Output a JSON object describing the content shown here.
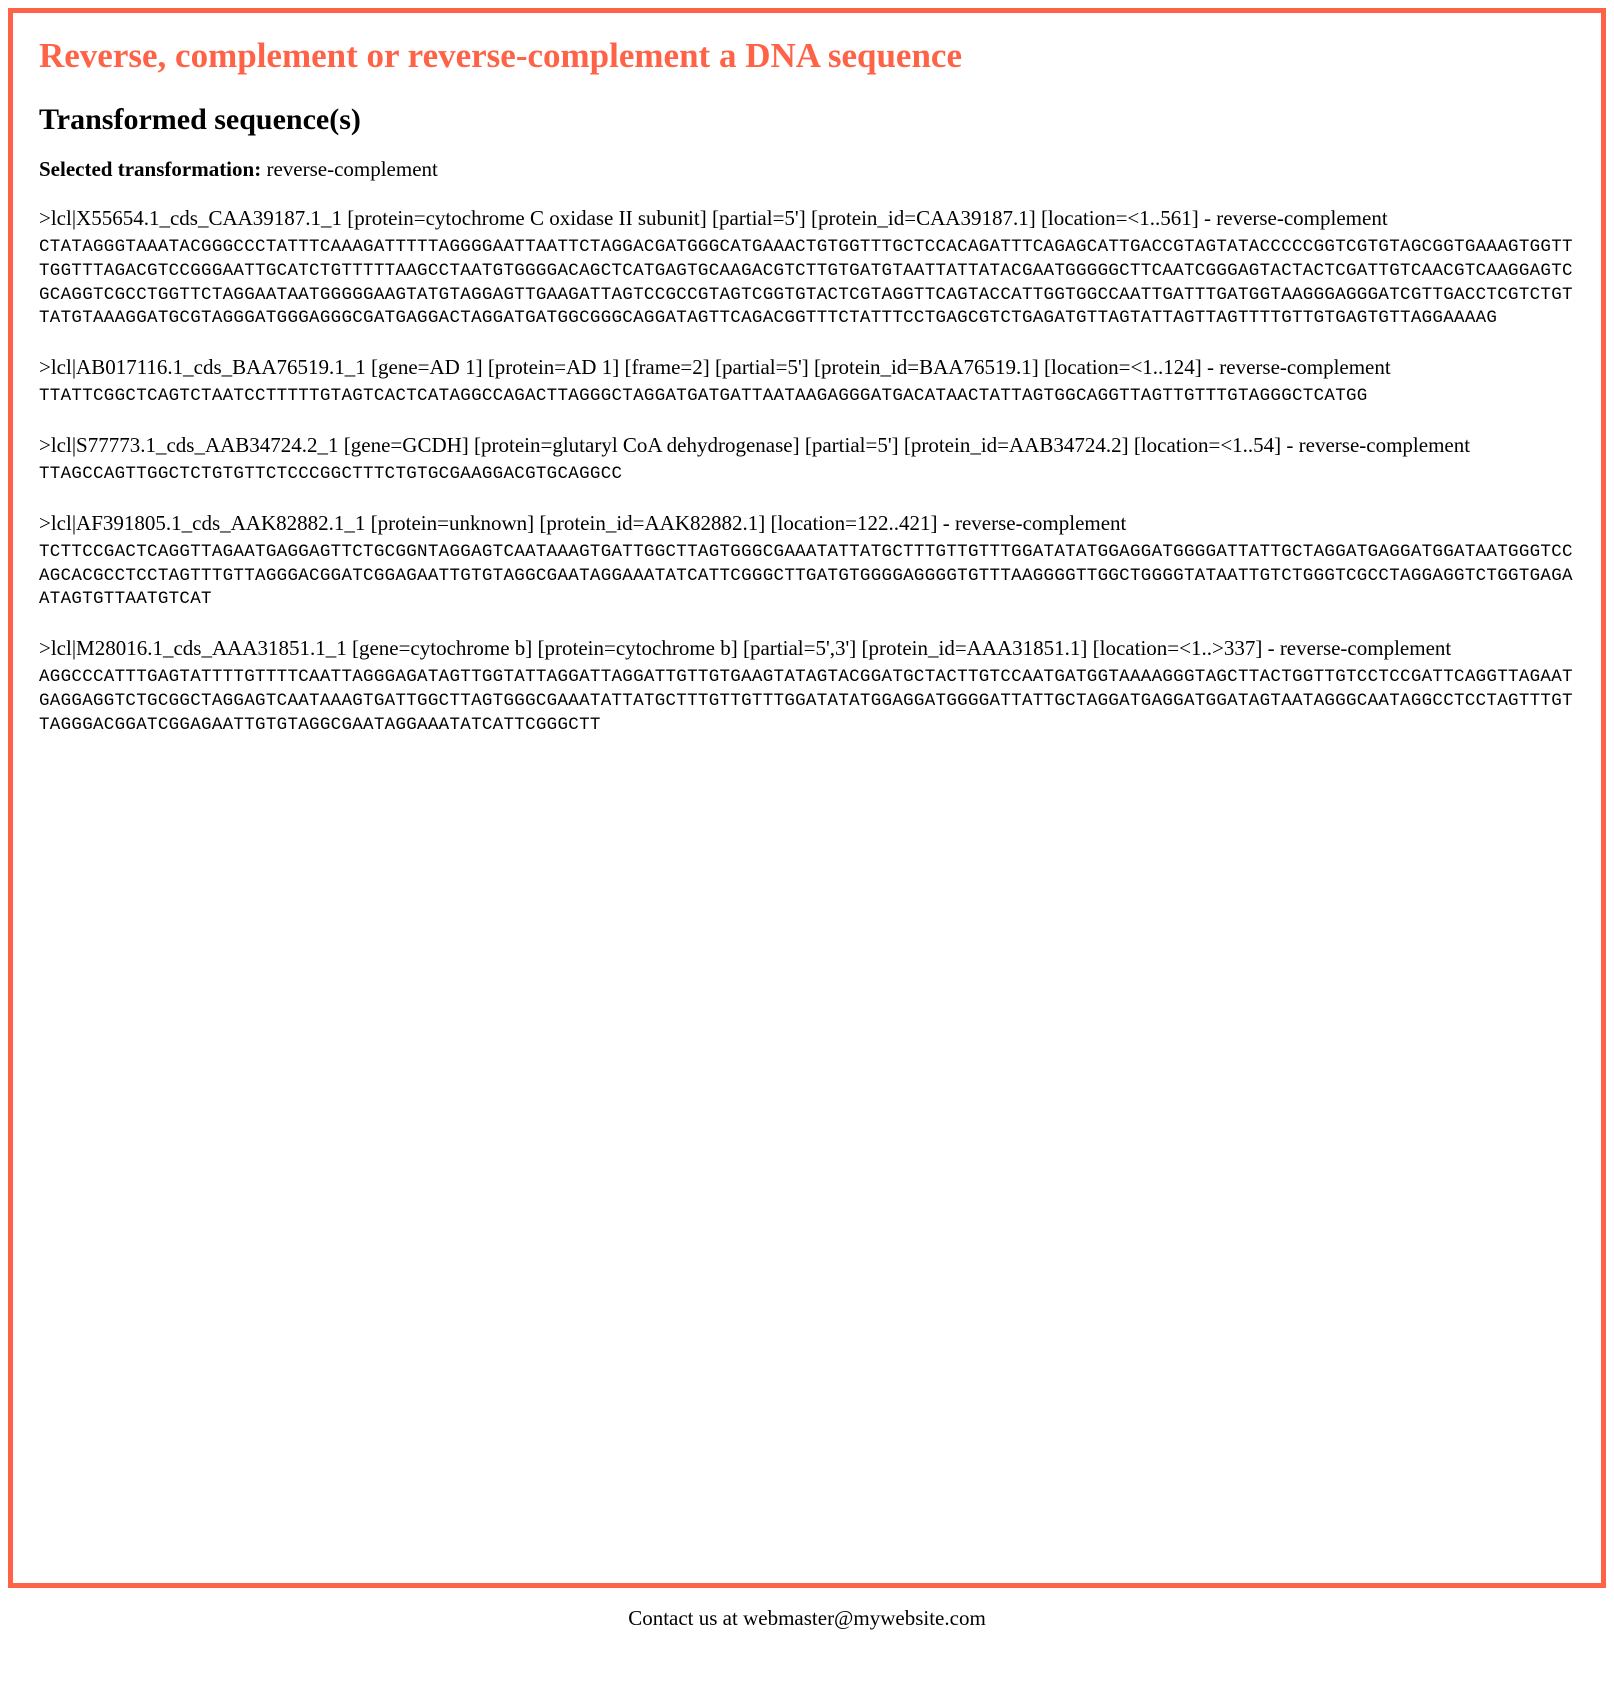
{
  "title": "Reverse, complement or reverse-complement a DNA sequence",
  "subtitle": "Transformed sequence(s)",
  "selected_transformation_label": "Selected transformation:",
  "selected_transformation_value": "reverse-complement",
  "sequences": [
    {
      "header": ">lcl|X55654.1_cds_CAA39187.1_1 [protein=cytochrome C oxidase II subunit] [partial=5'] [protein_id=CAA39187.1] [location=<1..561] - reverse-complement",
      "data": "CTATAGGGTAAATACGGGCCCTATTTCAAAGATTTTTAGGGGAATTAATTCTAGGACGATGGGCATGAAACTGTGGTTTGCTCCACAGATTTCAGAGCATTGACCGTAGTATACCCCCGGTCGTGTAGCGGTGAAAGTGGTTTGGTTTAGACGTCCGGGAATTGCATCTGTTTTTAAGCCTAATGTGGGGACAGCTCATGAGTGCAAGACGTCTTGTGATGTAATTATTATACGAATGGGGGCTTCAATCGGGAGTACTACTCGATTGTCAACGTCAAGGAGTCGCAGGTCGCCTGGTTCTAGGAATAATGGGGGAAGTATGTAGGAGTTGAAGATTAGTCCGCCGTAGTCGGTGTACTCGTAGGTTCAGTACCATTGGTGGCCAATTGATTTGATGGTAAGGGAGGGATCGTTGACCTCGTCTGTTATGTAAAGGATGCGTAGGGATGGGAGGGCGATGAGGACTAGGATGATGGCGGGCAGGATAGTTCAGACGGTTTCTATTTCCTGAGCGTCTGAGATGTTAGTATTAGTTAGTTTTGTTGTGAGTGTTAGGAAAAG"
    },
    {
      "header": ">lcl|AB017116.1_cds_BAA76519.1_1 [gene=AD 1] [protein=AD 1] [frame=2] [partial=5'] [protein_id=BAA76519.1] [location=<1..124] - reverse-complement",
      "data": "TTATTCGGCTCAGTCTAATCCTTTTTGTAGTCACTCATAGGCCAGACTTAGGGCTAGGATGATGATTAATAAGAGGGATGACATAACTATTAGTGGCAGGTTAGTTGTTTGTAGGGCTCATGG"
    },
    {
      "header": ">lcl|S77773.1_cds_AAB34724.2_1 [gene=GCDH] [protein=glutaryl CoA dehydrogenase] [partial=5'] [protein_id=AAB34724.2] [location=<1..54] - reverse-complement",
      "data": "TTAGCCAGTTGGCTCTGTGTTCTCCCGGCTTTCTGTGCGAAGGACGTGCAGGCC"
    },
    {
      "header": ">lcl|AF391805.1_cds_AAK82882.1_1 [protein=unknown] [protein_id=AAK82882.1] [location=122..421] - reverse-complement",
      "data": "TCTTCCGACTCAGGTTAGAATGAGGAGTTCTGCGGNTAGGAGTCAATAAAGTGATTGGCTTAGTGGGCGAAATATTATGCTTTGTTGTTTGGATATATGGAGGATGGGGATTATTGCTAGGATGAGGATGGATAATGGGTCCAGCACGCCTCCTAGTTTGTTAGGGACGGATCGGAGAATTGTGTAGGCGAATAGGAAATATCATTCGGGCTTGATGTGGGGAGGGGTGTTTAAGGGGTTGGCTGGGGTATAATTGTCTGGGTCGCCTAGGAGGTCTGGTGAGAATAGTGTTAATGTCAT"
    },
    {
      "header": ">lcl|M28016.1_cds_AAA31851.1_1 [gene=cytochrome b] [protein=cytochrome b] [partial=5',3'] [protein_id=AAA31851.1] [location=<1..>337] - reverse-complement",
      "data": "AGGCCCATTTGAGTATTTTGTTTTCAATTAGGGAGATAGTTGGTATTAGGATTAGGATTGTTGTGAAGTATAGTACGGATGCTACTTGTCCAATGATGGTAAAAGGGTAGCTTACTGGTTGTCCTCCGATTCAGGTTAGAATGAGGAGGTCTGCGGCTAGGAGTCAATAAAGTGATTGGCTTAGTGGGCGAAATATTATGCTTTGTTGTTTGGATATATGGAGGATGGGGATTATTGCTAGGATGAGGATGGATAGTAATAGGGCAATAGGCCTCCTAGTTTGTTAGGGACGGATCGGAGAATTGTGTAGGCGAATAGGAAATATCATTCGGGCTT"
    }
  ],
  "footer_prefix": "Contact us at ",
  "footer_email": "webmaster@mywebsite.com"
}
